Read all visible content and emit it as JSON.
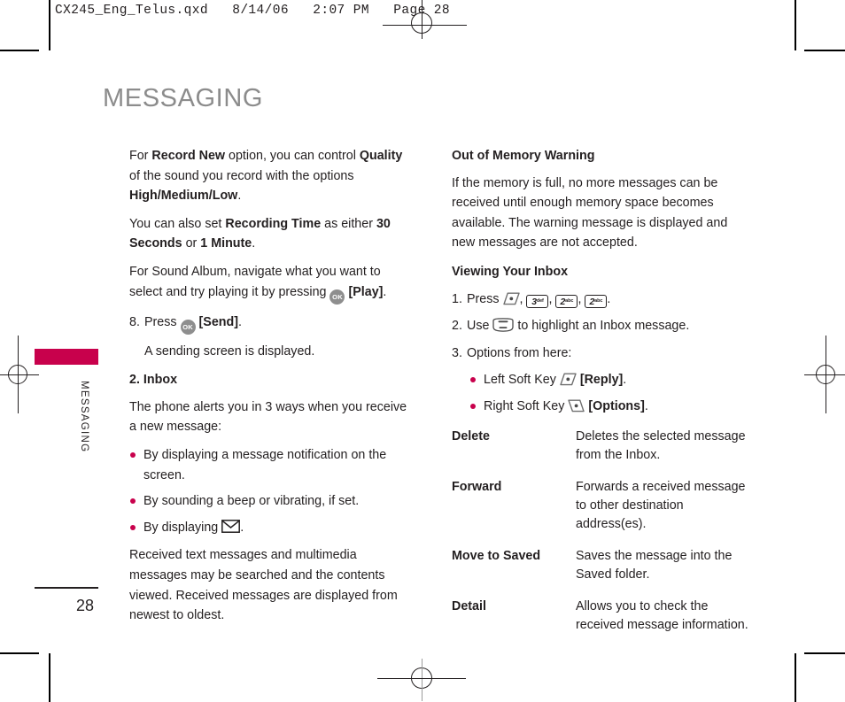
{
  "header": {
    "slug": "CX245_Eng_Telus.qxd   8/14/06   2:07 PM   Page 28"
  },
  "chapter": {
    "title": "MESSAGING",
    "side_label": "MESSAGING",
    "folio": "28"
  },
  "colors": {
    "accent": "#c8014c",
    "title_gray": "#8c8c8c",
    "body": "#231f20",
    "key_gray": "#8e8e8e"
  },
  "left_column": {
    "para_record_new": {
      "t1": "For ",
      "b1": "Record New",
      "t2": " option, you can control ",
      "b2": "Quality",
      "t3": " of the sound you record with the options ",
      "b3": "High/Medium/Low",
      "t4": "."
    },
    "para_recording_time": {
      "t1": "You can also set ",
      "b1": "Recording Time",
      "t2": " as either ",
      "b2": "30 Seconds",
      "t3": " or ",
      "b3": "1 Minute",
      "t4": "."
    },
    "para_sound_album": {
      "t1": "For Sound Album, navigate what you want to select and try playing it by pressing ",
      "icon": "ok-key",
      "t2": " ",
      "b1": "[Play]",
      "t3": "."
    },
    "step_8": {
      "num": "8.",
      "t1": "Press ",
      "icon": "ok-key",
      "t2": " ",
      "b1": "[Send]",
      "t3": ".",
      "subtext": "A sending screen is displayed."
    },
    "inbox_heading": "2. Inbox",
    "para_alerts": "The phone alerts you in 3 ways when you receive a new message:",
    "alert_bullets": [
      {
        "text": "By displaying a message notification on the screen."
      },
      {
        "text": "By sounding a beep or vibrating, if set."
      },
      {
        "text_before": "By displaying ",
        "icon": "envelope-icon",
        "text_after": "."
      }
    ],
    "para_received": "Received text messages and multimedia messages may be searched and the contents viewed. Received messages are displayed from newest to oldest."
  },
  "right_column": {
    "out_of_memory_heading": "Out of Memory Warning",
    "out_of_memory_body": "If the memory is full, no more messages can be received until enough memory space becomes available. The warning message is displayed and new messages are not accepted.",
    "viewing_inbox_heading": "Viewing Your Inbox",
    "step_1": {
      "num": "1.",
      "label": "Press ",
      "keys": [
        {
          "type": "softkey-left"
        },
        {
          "type": "numkey",
          "digit": "3",
          "letters": "def"
        },
        {
          "type": "numkey",
          "digit": "2",
          "letters": "abc"
        },
        {
          "type": "numkey",
          "digit": "2",
          "letters": "abc"
        }
      ],
      "trailing": "."
    },
    "step_2": {
      "num": "2.",
      "t1": "Use ",
      "icon": "nav-key-icon",
      "t2": " to highlight an Inbox message."
    },
    "step_3": {
      "num": "3.",
      "label": "Options from here:"
    },
    "softkey_bullets": [
      {
        "label": "Left Soft Key ",
        "icon": "left-soft-key-icon",
        "bold": "[Reply]",
        "tail": "."
      },
      {
        "label": "Right Soft Key ",
        "icon": "right-soft-key-icon",
        "bold": "[Options]",
        "tail": "."
      }
    ],
    "options_table": [
      {
        "term": "Delete",
        "desc": "Deletes the selected message from the Inbox."
      },
      {
        "term": "Forward",
        "desc": "Forwards a received message to other destination address(es)."
      },
      {
        "term": "Move to Saved",
        "desc": "Saves the message into the Saved folder."
      },
      {
        "term": "Detail",
        "desc": "Allows you to check the received message information."
      }
    ]
  }
}
